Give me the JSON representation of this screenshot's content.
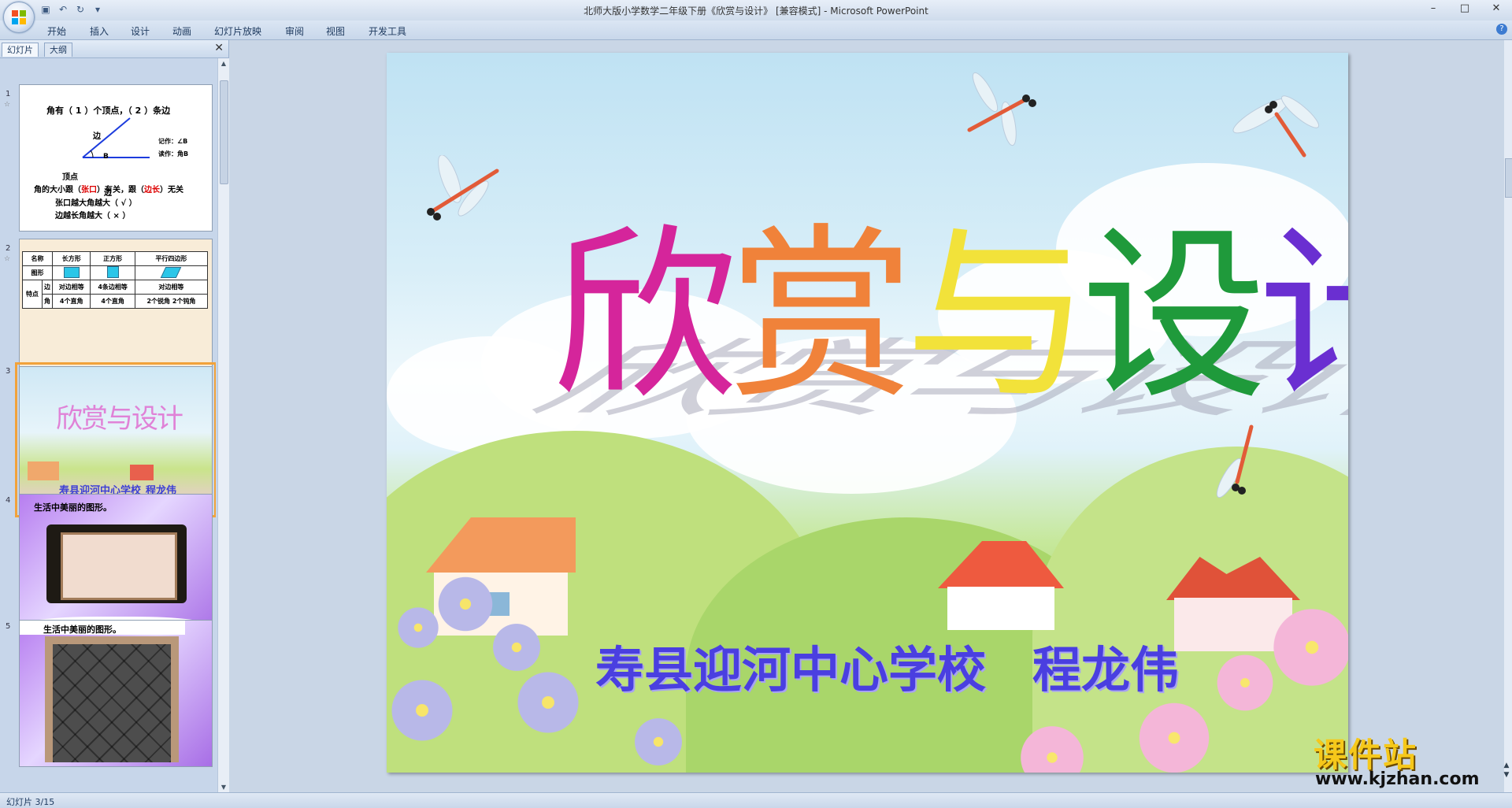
{
  "window": {
    "title": "北师大版小学数学二年级下册《欣赏与设计》 [兼容模式] - Microsoft PowerPoint"
  },
  "ribbon": {
    "tabs": [
      "开始",
      "插入",
      "设计",
      "动画",
      "幻灯片放映",
      "审阅",
      "视图",
      "开发工具"
    ]
  },
  "pane": {
    "tabs": [
      "幻灯片",
      "大纲"
    ],
    "close": "✕"
  },
  "thumb1": {
    "line1": "角有（ 1 ）个顶点，（ 2 ）条边",
    "side_a": "边",
    "side_b": "边",
    "vertex": "顶点",
    "angle_b": "B",
    "write_as": "记作：∠B",
    "read_as": "读作：角B",
    "line2_a": "角的大小跟（",
    "line2_red1": "张口",
    "line2_b": "）有关，跟（",
    "line2_red2": "边长",
    "line2_c": "）无关",
    "line3": "张口越大角越大（ √ ）",
    "line4": "边越长角越大（ × ）"
  },
  "thumb2": {
    "headers": [
      "名称",
      "长方形",
      "正方形",
      "平行四边形"
    ],
    "row_shape": "图形",
    "row_feature": "特点",
    "row_edge": "边",
    "row_angle": "角",
    "edge_vals": [
      "对边相等",
      "4条边相等",
      "对边相等"
    ],
    "angle_vals": [
      "4个直角",
      "4个直角",
      "2个锐角 2个钝角"
    ]
  },
  "thumb3": {
    "title": "欣赏与设计",
    "school": "寿县迎河中心学校",
    "name": "程龙伟"
  },
  "thumb4": {
    "label": "生活中美丽的图形。"
  },
  "thumb5": {
    "label": "生活中美丽的图形。"
  },
  "slide_numbers": [
    "1",
    "2",
    "3",
    "4",
    "5"
  ],
  "slide": {
    "title_chars": [
      "欣",
      "赏",
      "与",
      "设",
      "计"
    ],
    "school": "寿县迎河中心学校",
    "author": "程龙伟"
  },
  "watermark": {
    "cn": "课件站",
    "url": "www.kjzhan.com"
  },
  "status": {
    "slide_info": "幻灯片 3/15"
  },
  "colors": {
    "selected_outline": "#f2a23a",
    "title_1": "#d5259b",
    "title_2": "#f0823a",
    "title_3": "#f2e23a",
    "title_4": "#1f9a3b",
    "title_5": "#6a2fd1"
  }
}
